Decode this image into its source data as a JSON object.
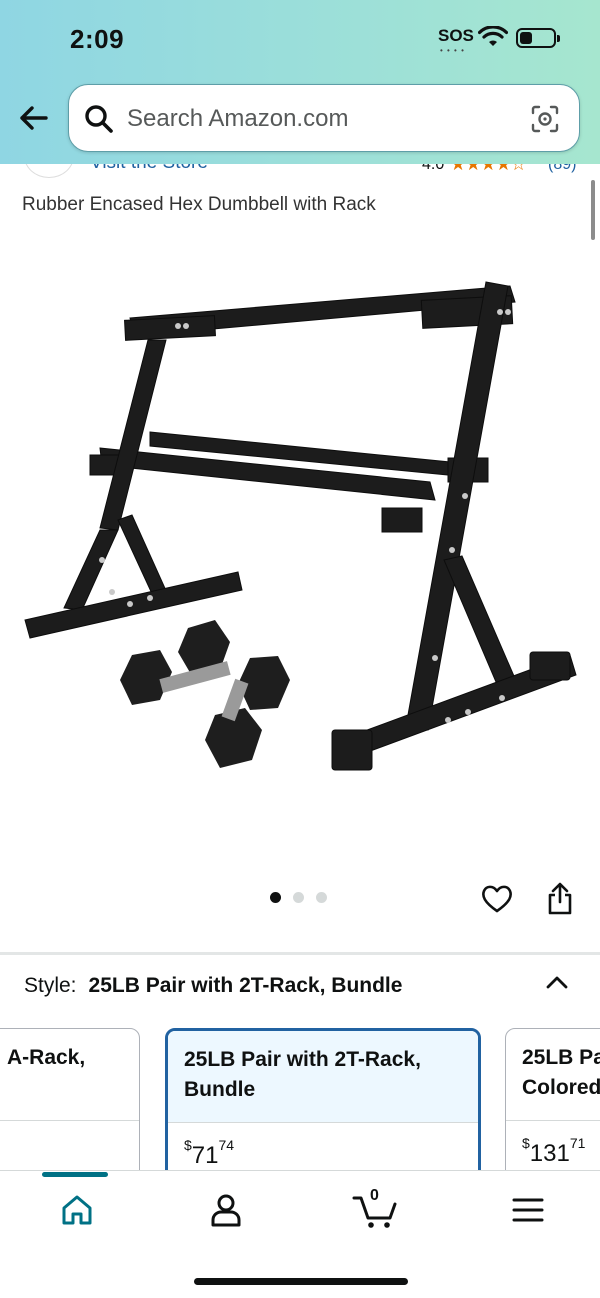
{
  "status_bar": {
    "time": "2:09",
    "sos": "SOS"
  },
  "search": {
    "placeholder": "Search Amazon.com"
  },
  "store": {
    "link": "Visit the Store",
    "rating": "4.0",
    "stars": "★★★★☆",
    "count": "(89)"
  },
  "product": {
    "title": "Rubber Encased Hex Dumbbell with Rack"
  },
  "gallery": {
    "image_count": 3,
    "active_index": 0
  },
  "style_selector": {
    "label": "Style:",
    "value": "25LB Pair with 2T-Rack, Bundle"
  },
  "variants": [
    {
      "name": "A-Rack,",
      "price_whole": "",
      "price_fraction": ""
    },
    {
      "name": "25LB Pair with 2T-Rack, Bundle",
      "price_whole": "71",
      "price_fraction": "74",
      "currency": "$"
    },
    {
      "name": "25LB Pa... Colored",
      "line1": "25LB Pa",
      "line2": "Colored",
      "price_whole": "131",
      "price_fraction": "71",
      "currency": "$"
    }
  ],
  "tabbar": {
    "cart_count": "0",
    "items": [
      "home",
      "account",
      "cart",
      "menu"
    ]
  },
  "colors": {
    "accent": "#007185",
    "link": "#2162a1",
    "star": "#e77600",
    "selected_border": "#2162a1"
  }
}
